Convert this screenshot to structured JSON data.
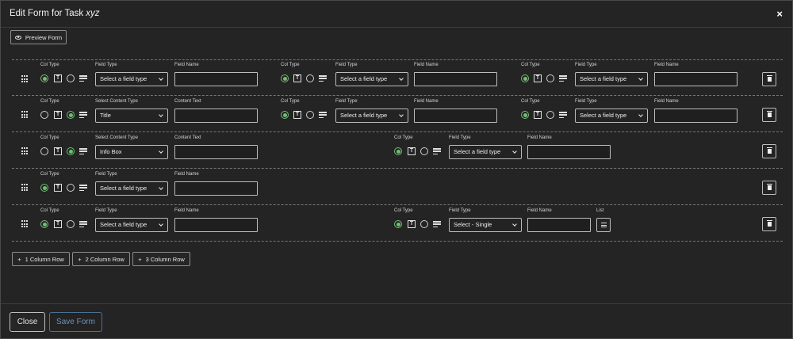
{
  "header": {
    "title_prefix": "Edit Form for Task ",
    "task_name": "xyz",
    "close_symbol": "×"
  },
  "toolbar": {
    "preview_label": "Preview Form"
  },
  "labels": {
    "col_type": "Col Type",
    "field_type": "Field Type",
    "field_name": "Field Name",
    "select_content_type": "Select Content Type",
    "content_text": "Content Text",
    "list": "List"
  },
  "values": {
    "select_field_type": "Select a field type",
    "title": "Title",
    "info_box": "Info Box",
    "select_single": "Select - Single"
  },
  "add_buttons": {
    "one": "1 Column Row",
    "two": "2 Column Row",
    "three": "3 Column Row",
    "plus": "+"
  },
  "footer": {
    "close_label": "Close",
    "save_label": "Save Form"
  },
  "colors": {
    "accent_green": "#6fbf73",
    "save_blue": "#6f93bb"
  }
}
